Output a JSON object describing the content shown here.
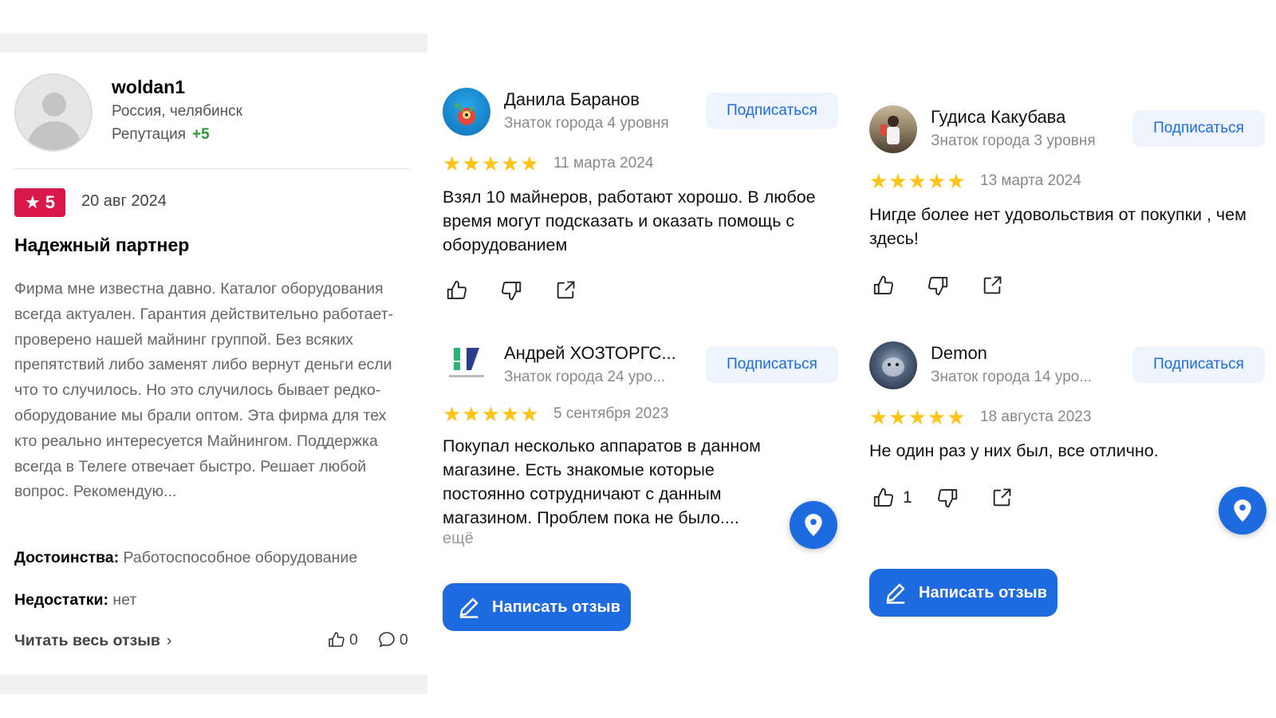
{
  "left_review": {
    "author": "woldan1",
    "location": "Россия, челябинск",
    "reputation_label": "Репутация",
    "reputation_value": "+5",
    "rating": "5",
    "date": "20 авг 2024",
    "title": "Надежный партнер",
    "text": "Фирма мне известна давно. Каталог оборудования всегда актуален. Гарантия действительно работает-проверено нашей майнинг группой. Без всяких препятствий либо заменят либо вернут деньги если что то случилось. Но это случилось бывает редко-оборудование мы брали оптом. Эта фирма для тех кто реально интересуется Майнингом. Поддержка всегда в Телеге отвечает быстро. Решает любой вопрос. Рекомендую...",
    "pros_label": "Достоинства:",
    "pros": "Работоспособное оборудование",
    "cons_label": "Недостатки:",
    "cons": "нет",
    "read_all": "Читать весь отзыв",
    "likes": "0",
    "comments": "0"
  },
  "yandex_reviews": [
    {
      "name": "Данила Баранов",
      "level": "Знаток города 4 уровня",
      "subscribe": "Подписаться",
      "date": "11 марта 2024",
      "text": "Взял 10 майнеров, работают хорошо. В любое время могут подсказать и оказать помощь с оборудованием",
      "stars": 5,
      "avatar_color": "#1a8fd6"
    },
    {
      "name": "Андрей ХОЗТОРГС...",
      "level": "Знаток города 24 уро...",
      "subscribe": "Подписаться",
      "date": "5 сентября 2023",
      "text": "Покупал несколько аппаратов в данном магазине. Есть знакомые которые постоянно сотрудничают с данным магазином. Проблем пока не было....",
      "more": "ещё",
      "stars": 5
    },
    {
      "name": "Гудиса Какубава",
      "level": "Знаток города 3 уровня",
      "subscribe": "Подписаться",
      "date": "13 марта 2024",
      "text": "Нигде более нет удовольствия от покупки , чем здесь!",
      "stars": 5
    },
    {
      "name": "Demon",
      "level": "Знаток города 14 уро...",
      "subscribe": "Подписаться",
      "date": "18 августа 2023",
      "text": "Не один раз у них был, все отлично.",
      "likes": "1",
      "stars": 5
    }
  ],
  "write_review": "Написать отзыв",
  "colors": {
    "accent": "#1e6be0",
    "badge": "#d9184a",
    "star": "#fcc419",
    "reputation": "#2e9a2e"
  }
}
